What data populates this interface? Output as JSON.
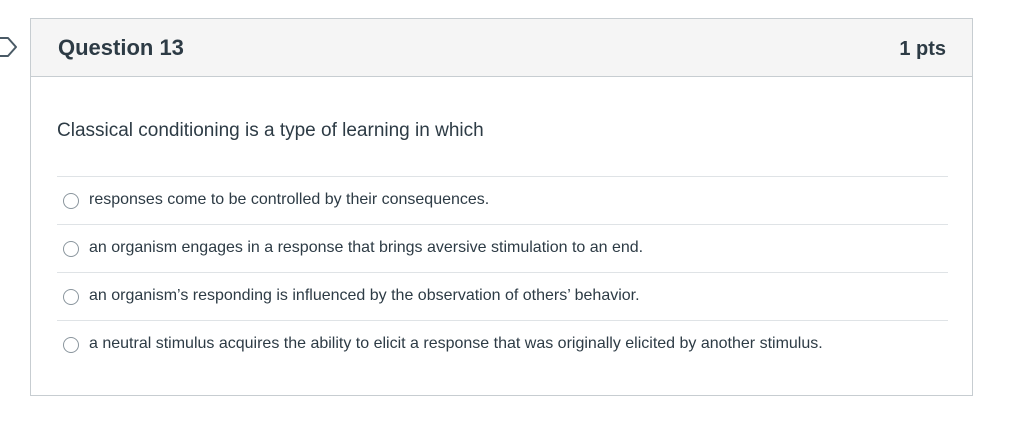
{
  "question": {
    "title": "Question 13",
    "points": "1 pts",
    "text": "Classical conditioning is a type of learning in which",
    "answers": [
      {
        "label": "responses come to be controlled by their consequences.",
        "selected": false
      },
      {
        "label": "an organism engages in a response that brings aversive stimulation to an end.",
        "selected": false
      },
      {
        "label": "an organism’s responding is influenced by the observation of others’ behavior.",
        "selected": false
      },
      {
        "label": "a neutral stimulus acquires the ability to elicit a response that was originally elicited by another stimulus.",
        "selected": false
      }
    ]
  },
  "colors": {
    "text": "#2d3b45",
    "header_bg": "#f5f5f5",
    "border": "#c7cdd1",
    "divider": "#dfe3e6"
  },
  "icons": {
    "flag": "flag-outline-icon"
  }
}
